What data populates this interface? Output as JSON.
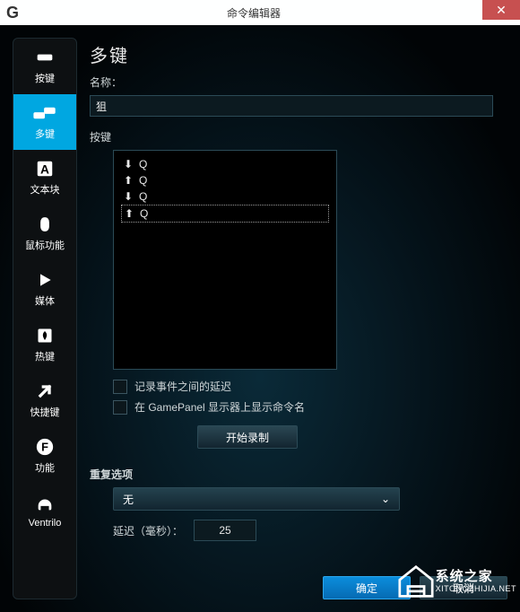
{
  "window": {
    "title": "命令编辑器",
    "logo_text": "G"
  },
  "sidebar": {
    "items": [
      {
        "id": "keys",
        "label": "按键",
        "icon": "keycap-icon",
        "selected": false
      },
      {
        "id": "multikey",
        "label": "多键",
        "icon": "multikey-icon",
        "selected": true
      },
      {
        "id": "textblock",
        "label": "文本块",
        "icon": "text-a-icon",
        "selected": false
      },
      {
        "id": "mouse",
        "label": "鼠标功能",
        "icon": "mouse-icon",
        "selected": false
      },
      {
        "id": "media",
        "label": "媒体",
        "icon": "play-icon",
        "selected": false
      },
      {
        "id": "hotkey",
        "label": "热键",
        "icon": "flame-icon",
        "selected": false
      },
      {
        "id": "shortcut",
        "label": "快捷键",
        "icon": "arrow-ne-icon",
        "selected": false
      },
      {
        "id": "function",
        "label": "功能",
        "icon": "function-icon",
        "selected": false
      },
      {
        "id": "ventrilo",
        "label": "Ventrilo",
        "icon": "headset-icon",
        "selected": false
      }
    ]
  },
  "main": {
    "heading": "多键",
    "name_label": "名称：",
    "name_value": "狙",
    "keys_label": "按键",
    "key_rows": [
      {
        "dir": "down",
        "key": "Q",
        "selected": false
      },
      {
        "dir": "up",
        "key": "Q",
        "selected": false
      },
      {
        "dir": "down",
        "key": "Q",
        "selected": false
      },
      {
        "dir": "up",
        "key": "Q",
        "selected": true
      }
    ],
    "record_delay_label": "记录事件之间的延迟",
    "show_gamepanel_label": "在 GamePanel 显示器上显示命令名",
    "start_record_label": "开始录制",
    "repeat_label": "重复选项",
    "repeat_value": "无",
    "delay_label": "延迟（毫秒）：",
    "delay_value": "25"
  },
  "footer": {
    "ok": "确定",
    "cancel": "取消"
  },
  "watermark": {
    "line1": "系统之家",
    "line2": "XITONGZHIJIA.NET"
  },
  "colors": {
    "accent": "#00a7e1"
  }
}
